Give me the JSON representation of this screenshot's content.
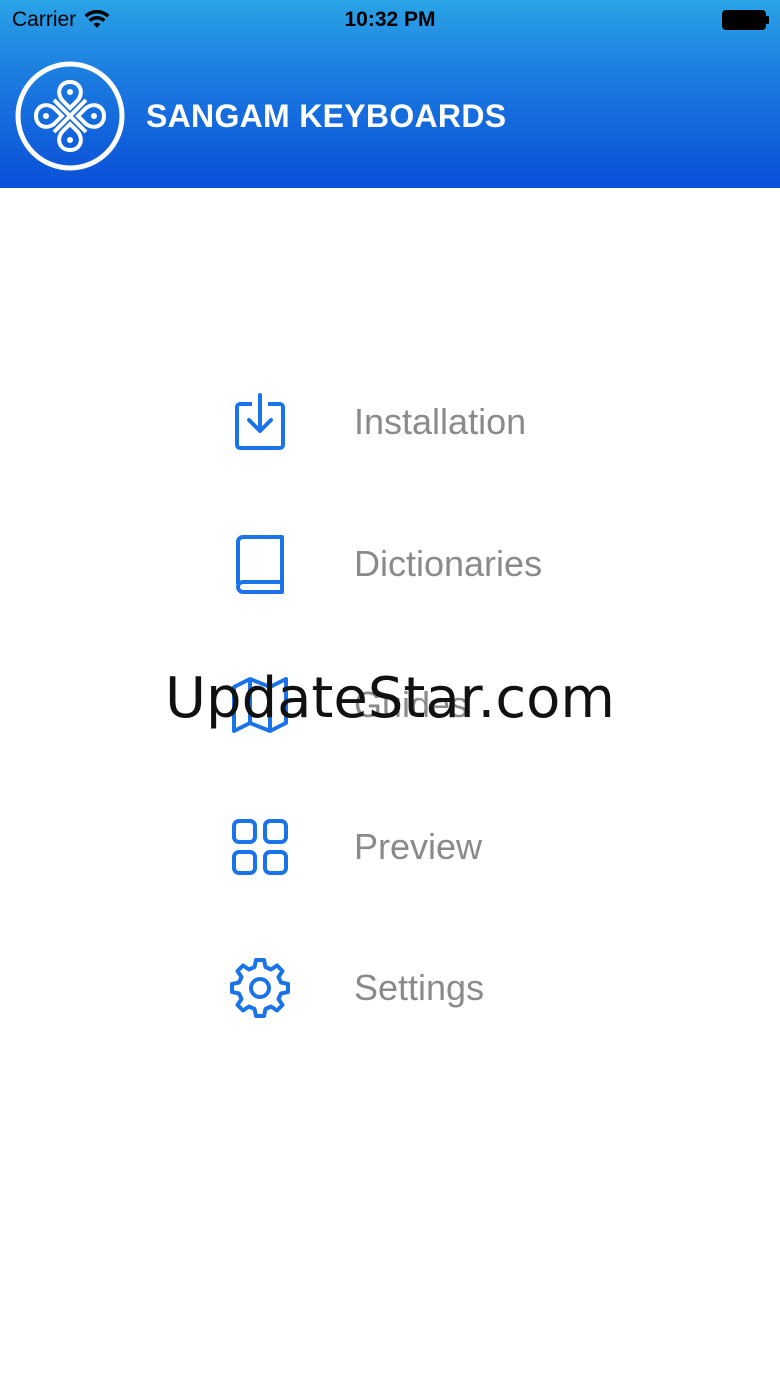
{
  "status_bar": {
    "carrier": "Carrier",
    "time": "10:32 PM"
  },
  "header": {
    "title": "SANGAM KEYBOARDS",
    "logo_icon": "knot-logo-icon",
    "gradient_top": "#2aa3e6",
    "gradient_bottom": "#0b4fd8"
  },
  "menu": {
    "accent_color": "#1a73e8",
    "label_color": "#8a8a8a",
    "items": [
      {
        "label": "Installation",
        "icon": "download-icon"
      },
      {
        "label": "Dictionaries",
        "icon": "book-icon"
      },
      {
        "label": "Guides",
        "icon": "map-icon"
      },
      {
        "label": "Preview",
        "icon": "grid-icon"
      },
      {
        "label": "Settings",
        "icon": "gear-icon"
      }
    ]
  },
  "watermark": {
    "text": "UpdateStar.com"
  }
}
